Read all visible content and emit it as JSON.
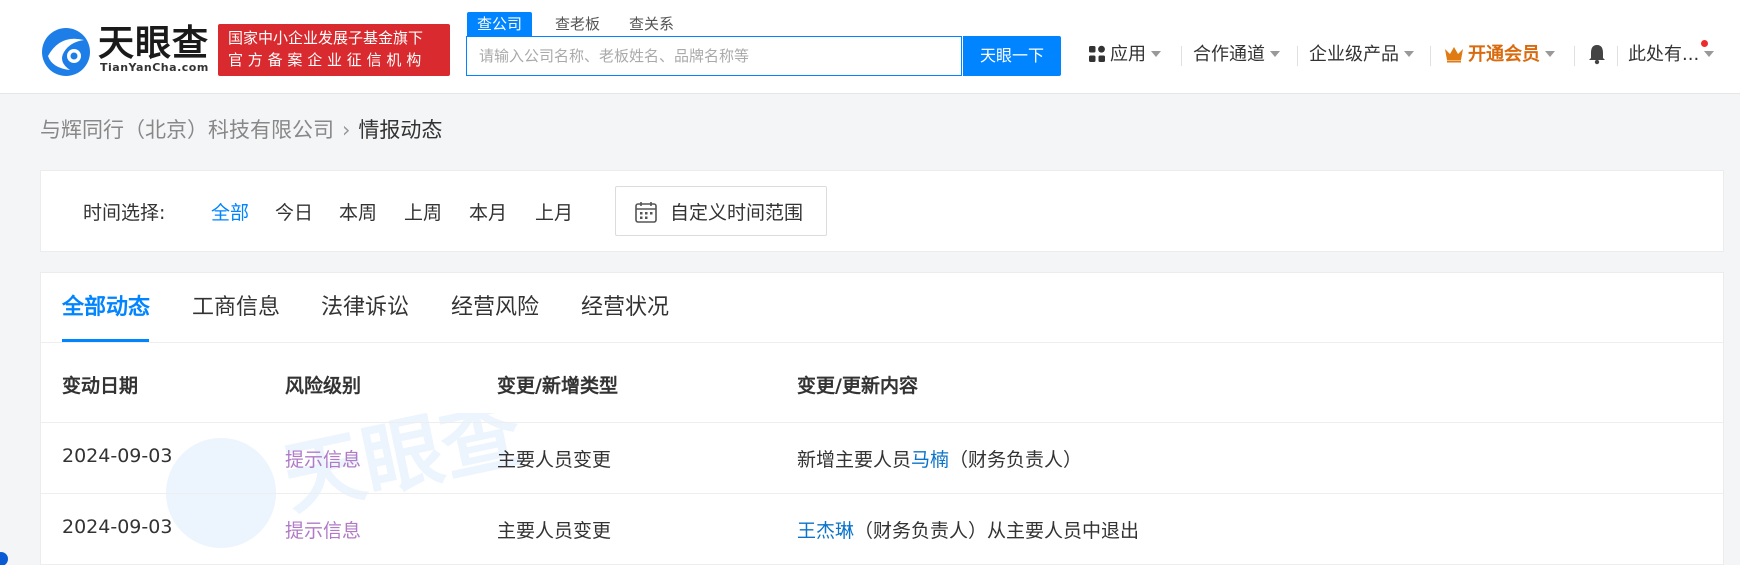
{
  "header": {
    "logo_cn": "天眼查",
    "logo_en": "TianYanCha.com",
    "badge_line1": "国家中小企业发展子基金旗下",
    "badge_line2": "官方备案企业征信机构",
    "search_tabs": [
      "查公司",
      "查老板",
      "查关系"
    ],
    "search_placeholder": "请输入公司名称、老板姓名、品牌名称等",
    "search_button": "天眼一下",
    "nav": {
      "apps": "应用",
      "partner": "合作通道",
      "enterprise": "企业级产品",
      "vip": "开通会员",
      "user": "此处有..."
    }
  },
  "breadcrumb": {
    "company": "与辉同行（北京）科技有限公司",
    "current": "情报动态"
  },
  "filter": {
    "label": "时间选择:",
    "options": [
      "全部",
      "今日",
      "本周",
      "上周",
      "本月",
      "上月"
    ],
    "custom_range": "自定义时间范围"
  },
  "tabs": [
    "全部动态",
    "工商信息",
    "法律诉讼",
    "经营风险",
    "经营状况"
  ],
  "table": {
    "headers": [
      "变动日期",
      "风险级别",
      "变更/新增类型",
      "变更/更新内容"
    ],
    "rows": [
      {
        "date": "2024-09-03",
        "risk": "提示信息",
        "type": "主要人员变更",
        "content_prefix": "新增主要人员",
        "content_link": "马楠",
        "content_suffix": "（财务负责人）"
      },
      {
        "date": "2024-09-03",
        "risk": "提示信息",
        "type": "主要人员变更",
        "content_prefix": "",
        "content_link": "王杰琳",
        "content_suffix": "（财务负责人）从主要人员中退出"
      }
    ]
  },
  "colors": {
    "accent": "#0084ff",
    "badge_red": "#d92b2f",
    "vip_orange": "#d96a0e",
    "risk_purple": "#b07ac7",
    "link_blue": "#0b73c9"
  },
  "icons": [
    "tianyancha-logo-icon",
    "apps-grid-icon",
    "crown-icon",
    "bell-icon",
    "calendar-icon",
    "caret-down-icon"
  ]
}
